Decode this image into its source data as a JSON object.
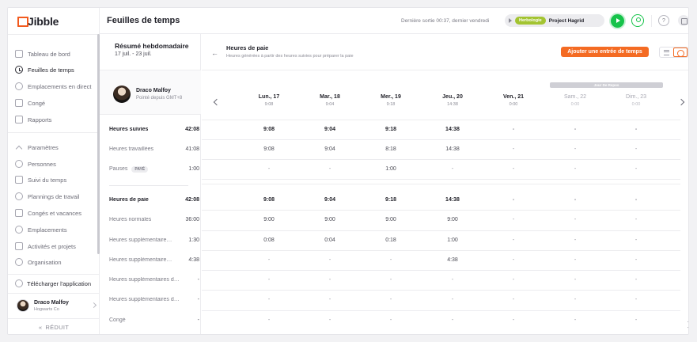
{
  "app": {
    "brand": "Jibble"
  },
  "sidebar": {
    "primary": [
      {
        "label": "Tableau de bord",
        "icon": "dashboard-icon"
      },
      {
        "label": "Feuilles de temps",
        "icon": "clock-icon",
        "active": true
      },
      {
        "label": "Emplacements en direct",
        "icon": "map-pin-icon"
      },
      {
        "label": "Congé",
        "icon": "calendar-icon"
      },
      {
        "label": "Rapports",
        "icon": "report-icon"
      }
    ],
    "secondary": [
      {
        "label": "Paramètres",
        "icon": "chevron-up-icon"
      },
      {
        "label": "Personnes",
        "icon": "people-icon"
      },
      {
        "label": "Suivi du temps",
        "icon": "time-tracking-icon"
      },
      {
        "label": "Plannings de travail",
        "icon": "schedule-icon"
      },
      {
        "label": "Congés et vacances",
        "icon": "holiday-icon"
      },
      {
        "label": "Emplacements",
        "icon": "location-icon"
      },
      {
        "label": "Activités et projets",
        "icon": "tag-icon"
      },
      {
        "label": "Organisation",
        "icon": "gear-icon"
      }
    ],
    "download_label": "Télécharger l'application",
    "user": {
      "name": "Draco Malfoy",
      "org": "Hogwarts Co"
    },
    "collapse_label": "RÉDUIT"
  },
  "topbar": {
    "title": "Feuilles de temps",
    "last_out": "Dernière sortie 00:37, dernier vendredi",
    "activity_tag": "Herbologie",
    "project": "Project Hagrid"
  },
  "summary": {
    "title": "Résumé hebdomadaire",
    "range": "17 juil. - 23 juil.",
    "employee": {
      "name": "Draco Malfoy",
      "since": "Pointé depuis GMT+8"
    },
    "rows": [
      {
        "label": "Heures suivies",
        "value": "42:08",
        "bold": true
      },
      {
        "label": "Heures travaillées",
        "value": "41:08"
      },
      {
        "label": "Pauses",
        "badge": "PAYÉ",
        "value": "1:00"
      },
      {
        "label": "Heures de paie",
        "value": "42:08",
        "bold": true
      },
      {
        "label": "Heures normales",
        "value": "36:00"
      },
      {
        "label": "Heures supplémentaire…",
        "value": "1:30"
      },
      {
        "label": "Heures supplémentaire…",
        "value": "4:38"
      },
      {
        "label": "Heures supplémentaires d…",
        "value": "-"
      },
      {
        "label": "Heures supplémentaires d…",
        "value": "-"
      },
      {
        "label": "Congé",
        "value": "-"
      }
    ]
  },
  "main": {
    "title": "Heures de paie",
    "subtitle": "Heures générées à partir des heures suivies pour préparer la paie",
    "add_button": "Ajouter une entrée de temps",
    "weekend_label": "Jour De Repos",
    "days": [
      {
        "name": "Lun., 17",
        "total": "9:08"
      },
      {
        "name": "Mar., 18",
        "total": "9:04"
      },
      {
        "name": "Mer., 19",
        "total": "9:18"
      },
      {
        "name": "Jeu., 20",
        "total": "14:38"
      },
      {
        "name": "Ven., 21",
        "total": "0:00"
      },
      {
        "name": "Sam., 22",
        "total": "0:00",
        "off": true
      },
      {
        "name": "Dim., 23",
        "total": "0:00",
        "off": true
      }
    ],
    "rows": [
      [
        "9:08",
        "9:04",
        "9:18",
        "14:38",
        "-",
        "-",
        "-"
      ],
      [
        "9:08",
        "9:04",
        "8:18",
        "14:38",
        "-",
        "-",
        "-"
      ],
      [
        "-",
        "-",
        "1:00",
        "-",
        "-",
        "-",
        "-"
      ],
      [
        "9:08",
        "9:04",
        "9:18",
        "14:38",
        "-",
        "-",
        "-"
      ],
      [
        "9:00",
        "9:00",
        "9:00",
        "9:00",
        "-",
        "-",
        "-"
      ],
      [
        "0:08",
        "0:04",
        "0:18",
        "1:00",
        "-",
        "-",
        "-"
      ],
      [
        "-",
        "-",
        "-",
        "4:38",
        "-",
        "-",
        "-"
      ],
      [
        "-",
        "-",
        "-",
        "-",
        "-",
        "-",
        "-"
      ],
      [
        "-",
        "-",
        "-",
        "-",
        "-",
        "-",
        "-"
      ],
      [
        "-",
        "-",
        "-",
        "-",
        "-",
        "-",
        "-"
      ]
    ]
  }
}
